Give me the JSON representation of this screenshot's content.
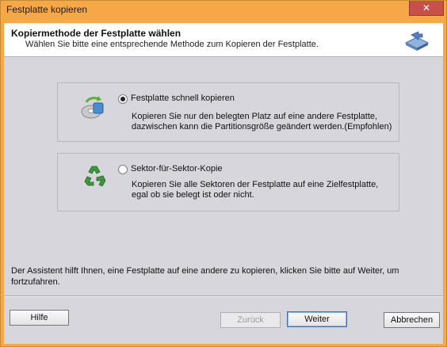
{
  "window": {
    "title": "Festplatte kopieren",
    "close_glyph": "✕"
  },
  "header": {
    "title": "Kopiermethode der Festplatte wählen",
    "subtitle": "Wählen Sie bitte eine entsprechende Methode zum Kopieren der Festplatte.",
    "icon": "disk-copy-icon"
  },
  "options": [
    {
      "label": "Festplatte schnell kopieren",
      "description_line1": "Kopieren Sie nur den belegten Platz auf eine andere Festplatte,",
      "description_line2": "dazwischen kann die Partitionsgröße geändert werden.(Empfohlen)",
      "selected": true,
      "icon": "fast-copy-icon"
    },
    {
      "label": "Sektor-für-Sektor-Kopie",
      "description_line1": "Kopieren Sie alle Sektoren der Festplatte auf eine Zielfestplatte,",
      "description_line2": "egal ob sie belegt ist oder nicht.",
      "selected": false,
      "icon": "recycle-icon"
    }
  ],
  "assistant_text": "Der Assistent hilft Ihnen, eine Festplatte auf eine andere zu kopieren, klicken Sie bitte auf Weiter, um fortzufahren.",
  "buttons": {
    "help": "Hilfe",
    "back": "Zurück",
    "next": "Weiter",
    "cancel": "Abbrechen"
  },
  "colors": {
    "titlebar": "#f5a845",
    "close": "#c7504a",
    "client_bg": "#d7d6dc"
  }
}
